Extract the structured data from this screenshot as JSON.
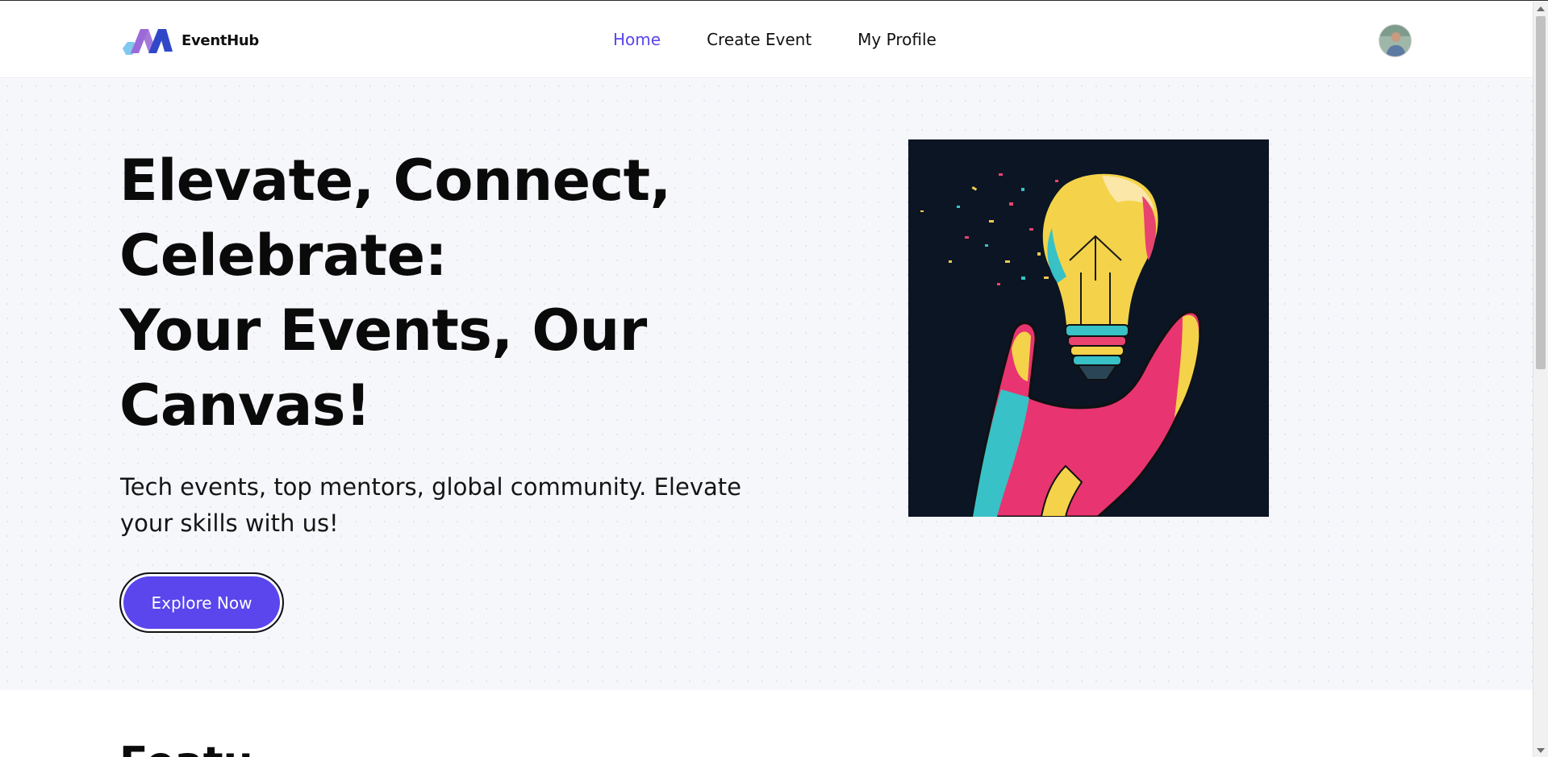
{
  "brand": {
    "name": "EventHub",
    "logo_icon": "eventhub-logo-icon"
  },
  "nav": {
    "items": [
      {
        "label": "Home",
        "active": true
      },
      {
        "label": "Create Event",
        "active": false
      },
      {
        "label": "My Profile",
        "active": false
      }
    ]
  },
  "user": {
    "avatar_icon": "user-avatar"
  },
  "hero": {
    "title_lines": [
      "Elevate, Connect,",
      "Celebrate:",
      "Your Events, Our",
      "Canvas!"
    ],
    "subtitle": "Tech events, top mentors, global community. Elevate your skills with us!",
    "cta_label": "Explore Now",
    "image_icon": "lightbulb-hand-illustration"
  },
  "next_section": {
    "heading": "Featu"
  },
  "colors": {
    "accent": "#5a46ec",
    "hero_bg": "#f6f7fb",
    "image_bg": "#0b1523"
  }
}
